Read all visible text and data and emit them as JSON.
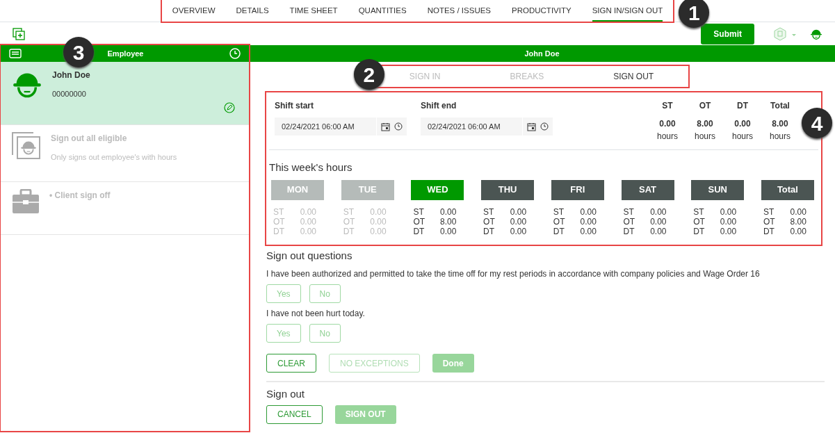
{
  "top_tabs": {
    "callout": "1",
    "items": [
      {
        "label": "OVERVIEW",
        "selected": false
      },
      {
        "label": "DETAILS",
        "selected": false
      },
      {
        "label": "TIME SHEET",
        "selected": false
      },
      {
        "label": "QUANTITIES",
        "selected": false
      },
      {
        "label": "NOTES / ISSUES",
        "selected": false
      },
      {
        "label": "PRODUCTIVITY",
        "selected": false
      },
      {
        "label": "SIGN IN/SIGN OUT",
        "selected": true
      }
    ]
  },
  "toolbar": {
    "submit": "Submit"
  },
  "sidebar": {
    "callout": "3",
    "header": "Employee",
    "items": [
      {
        "kind": "employee",
        "title": "John Doe",
        "subtitle": "00000000",
        "selected": true,
        "disabled": false
      },
      {
        "kind": "group",
        "title": "Sign out all eligible",
        "subtitle": "Only signs out employee's with hours",
        "selected": false,
        "disabled": true
      },
      {
        "kind": "client",
        "title": "• Client sign off",
        "selected": false,
        "disabled": true
      }
    ]
  },
  "main": {
    "header": "John Doe",
    "sub_tabs": {
      "callout": "2",
      "items": [
        {
          "label": "SIGN IN",
          "selected": false
        },
        {
          "label": "BREAKS",
          "selected": false
        },
        {
          "label": "SIGN OUT",
          "selected": true
        }
      ]
    },
    "summary": {
      "callout": "4",
      "shift_start": {
        "label": "Shift start",
        "value": "02/24/2021 06:00 AM"
      },
      "shift_end": {
        "label": "Shift end",
        "value": "02/24/2021 06:00 AM"
      },
      "totals": [
        {
          "label": "ST",
          "value": "0.00",
          "unit": "hours"
        },
        {
          "label": "OT",
          "value": "8.00",
          "unit": "hours"
        },
        {
          "label": "DT",
          "value": "0.00",
          "unit": "hours"
        },
        {
          "label": "Total",
          "value": "8.00",
          "unit": "hours"
        }
      ],
      "week_title": "This week's hours",
      "days": [
        {
          "label": "MON",
          "selected": false,
          "disabled": true,
          "rows": [
            [
              "ST",
              "0.00"
            ],
            [
              "OT",
              "0.00"
            ],
            [
              "DT",
              "0.00"
            ]
          ]
        },
        {
          "label": "TUE",
          "selected": false,
          "disabled": true,
          "rows": [
            [
              "ST",
              "0.00"
            ],
            [
              "OT",
              "0.00"
            ],
            [
              "DT",
              "0.00"
            ]
          ]
        },
        {
          "label": "WED",
          "selected": true,
          "disabled": false,
          "rows": [
            [
              "ST",
              "0.00"
            ],
            [
              "OT",
              "8.00"
            ],
            [
              "DT",
              "0.00"
            ]
          ]
        },
        {
          "label": "THU",
          "selected": false,
          "disabled": false,
          "rows": [
            [
              "ST",
              "0.00"
            ],
            [
              "OT",
              "0.00"
            ],
            [
              "DT",
              "0.00"
            ]
          ]
        },
        {
          "label": "FRI",
          "selected": false,
          "disabled": false,
          "rows": [
            [
              "ST",
              "0.00"
            ],
            [
              "OT",
              "0.00"
            ],
            [
              "DT",
              "0.00"
            ]
          ]
        },
        {
          "label": "SAT",
          "selected": false,
          "disabled": false,
          "rows": [
            [
              "ST",
              "0.00"
            ],
            [
              "OT",
              "0.00"
            ],
            [
              "DT",
              "0.00"
            ]
          ]
        },
        {
          "label": "SUN",
          "selected": false,
          "disabled": false,
          "rows": [
            [
              "ST",
              "0.00"
            ],
            [
              "OT",
              "0.00"
            ],
            [
              "DT",
              "0.00"
            ]
          ]
        },
        {
          "label": "Total",
          "selected": false,
          "disabled": false,
          "rows": [
            [
              "ST",
              "0.00"
            ],
            [
              "OT",
              "8.00"
            ],
            [
              "DT",
              "0.00"
            ]
          ]
        }
      ]
    },
    "questions_title": "Sign out questions",
    "questions": [
      {
        "text": "I have been authorized and permitted to take the time off for my rest periods in accordance with company policies and Wage Order 16",
        "yes": "Yes",
        "no": "No"
      },
      {
        "text": "I have not been hurt today.",
        "yes": "Yes",
        "no": "No"
      }
    ],
    "question_actions": [
      {
        "label": "CLEAR",
        "kind": "secondary",
        "disabled": false
      },
      {
        "label": "NO EXCEPTIONS",
        "kind": "secondary",
        "disabled": true
      },
      {
        "label": "Done",
        "kind": "primary",
        "disabled": true
      }
    ],
    "signout_title": "Sign out",
    "signout_actions": [
      {
        "label": "CANCEL",
        "kind": "secondary",
        "disabled": false
      },
      {
        "label": "SIGN OUT",
        "kind": "primary",
        "disabled": true
      }
    ]
  }
}
